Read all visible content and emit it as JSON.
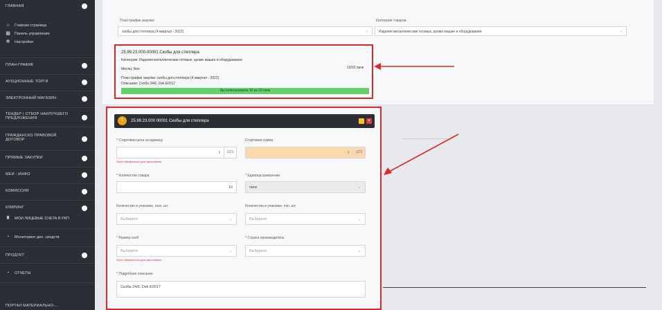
{
  "sidebar": {
    "sections": [
      {
        "label": "ГЛАВНАЯ"
      },
      {
        "label": "ПЛАН-ГРАФИК"
      },
      {
        "label": "АУКЦИОННЫЕ ТОРГИ"
      },
      {
        "label": "ЭЛЕКТРОННЫЙ МАГАЗИН"
      },
      {
        "label": "ТЕНДЕР | ОТБОР НАИЛУЧШЕГО ПРЕДЛОЖЕНИЯ"
      },
      {
        "label": "ГРАЖДАНСКО ПРАВОВОЙ ДОГОВОР"
      },
      {
        "label": "ПРЯМЫЕ ЗАКУПКИ"
      },
      {
        "label": "МЕИ - ИНФО"
      },
      {
        "label": "КОМИССИЯ"
      },
      {
        "label": "КЛИРИНГ"
      },
      {
        "label": "ПРОДУКТ"
      }
    ],
    "home_items": [
      {
        "label": "Главная страница",
        "icon": "home-icon"
      },
      {
        "label": "Панель управления",
        "icon": "dashboard-icon"
      },
      {
        "label": "Настройки",
        "icon": "gear-icon"
      }
    ],
    "clearing_item": {
      "label": "МОИ ЛИЦЕВЫЕ СЧЕТА В РКП",
      "icon": "bank-icon"
    },
    "monitoring_item": {
      "label": "Мониторинг ден. средств",
      "icon": "chart-icon"
    },
    "reports_item": {
      "label": "ОТЧЕТЫ",
      "icon": "chart-icon"
    },
    "bottom_cut": "ПОРТАЛ МАТЕРИАЛЬНО-..."
  },
  "filters": {
    "plan_label": "План-график закупки:",
    "plan_value": "скобы для степлера (4 квартал - 2022)",
    "category_label": "Категория товаров:",
    "category_value": "Изделия металлические готовые, кроме машин и оборудования"
  },
  "info_card": {
    "title": "25.99.23.000-00001 Скобы для степлера",
    "category": "Категория: Изделия металлические готовые, кроме машин и оборудования",
    "month": "Месяц: Nov",
    "count": "10/10 пачк",
    "plan": "План-график закупки: скобы для степлера (4 квартал - 2022)",
    "desc": "Описание: Скоба 24/6, Deli E0017",
    "progress_text": "Вы использовали 10 из 10 пачк",
    "progress": 1.0
  },
  "form": {
    "badge": "1",
    "title": "25.99.23.000 00001 Скобы для степлера",
    "price_label": "Стартовая цена за единицу",
    "price_value": "",
    "price_unit": "UZS",
    "price_error": "Поле обязательно для заполнения",
    "sum_label": "Стартовая сумма",
    "sum_value": "",
    "sum_unit": "UZS",
    "qty_label": "Количество товара",
    "qty_value": "10",
    "unit_label": "Единица измерения",
    "unit_value": "пачк",
    "pack_max_label": "Количество в упаковке, max. шт.",
    "pack_max_placeholder": "Выберите",
    "pack_min_label": "Количество в упаковке, min. шт.",
    "pack_min_placeholder": "Выберите",
    "size_label": "Размер скоб",
    "size_placeholder": "Выберите",
    "size_error": "Поле обязательно для заполнения",
    "country_label": "Страна производитель",
    "country_placeholder": "Выберите",
    "detail_label": "Подробное описание:",
    "detail_value": "Скоба 24/6, Deli E0017",
    "spin": "⇕",
    "caret": "⌄"
  },
  "colors": {
    "sidebar": "#2a2f35",
    "highlight": "#e0262a",
    "progress": "#63d06a",
    "badge": "#f0a11b"
  }
}
